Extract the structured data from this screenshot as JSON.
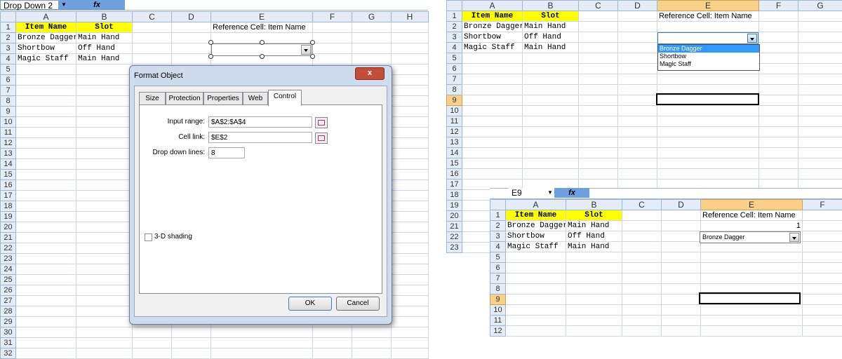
{
  "left": {
    "name_box": "Drop Down 2",
    "fx": "fx",
    "columns": [
      "A",
      "B",
      "C",
      "D",
      "E",
      "F",
      "G",
      "H"
    ],
    "rows": [
      "1",
      "2",
      "3",
      "4",
      "5",
      "6",
      "7",
      "8",
      "9",
      "10",
      "11",
      "12",
      "13",
      "14",
      "15",
      "16",
      "17",
      "18",
      "19",
      "20",
      "21",
      "22",
      "23",
      "24",
      "25",
      "26",
      "27",
      "28",
      "29",
      "30",
      "31",
      "32"
    ],
    "cells": [
      [
        "Item Name",
        "Slot",
        "",
        "",
        "Reference Cell: Item Name",
        "",
        "",
        ""
      ],
      [
        "Bronze Dagger",
        "Main Hand",
        "",
        "",
        "",
        "",
        "",
        ""
      ],
      [
        "Shortbow",
        "Off Hand",
        "",
        "",
        "",
        "",
        "",
        ""
      ],
      [
        "Magic Staff",
        "Main Hand",
        "",
        "",
        "",
        "",
        "",
        ""
      ]
    ]
  },
  "dialog": {
    "title": "Format Object",
    "close": "x",
    "tabs": [
      "Size",
      "Protection",
      "Properties",
      "Web",
      "Control"
    ],
    "active_tab": "Control",
    "input_range_label": "Input range:",
    "input_range_value": "$A$2:$A$4",
    "cell_link_label": "Cell link:",
    "cell_link_value": "$E$2",
    "drop_down_lines_label": "Drop down lines:",
    "drop_down_lines_value": "8",
    "shading_label": "3-D shading",
    "ok": "OK",
    "cancel": "Cancel"
  },
  "right_top": {
    "columns": [
      "A",
      "B",
      "C",
      "D",
      "E",
      "F",
      "G"
    ],
    "rows": [
      "1",
      "2",
      "3",
      "4",
      "5",
      "6",
      "7",
      "8",
      "9",
      "10",
      "11",
      "12",
      "13",
      "14",
      "15",
      "16",
      "17",
      "18",
      "19",
      "20",
      "21",
      "22",
      "23"
    ],
    "cells": [
      [
        "Item Name",
        "Slot",
        "",
        "",
        "Reference Cell: Item Name",
        "",
        ""
      ],
      [
        "Bronze Dagger",
        "Main Hand",
        "",
        "",
        "",
        "",
        ""
      ],
      [
        "Shortbow",
        "Off Hand",
        "",
        "",
        "",
        "",
        ""
      ],
      [
        "Magic Staff",
        "Main Hand",
        "",
        "",
        "",
        "",
        ""
      ]
    ],
    "dropdown_options": [
      "Bronze Dagger",
      "Shortbow",
      "Magic Staff"
    ],
    "dropdown_selected": "Bronze Dagger"
  },
  "right_bottom": {
    "name_box": "E9",
    "fx": "fx",
    "columns": [
      "A",
      "B",
      "C",
      "D",
      "E",
      "F"
    ],
    "rows": [
      "1",
      "2",
      "3",
      "4",
      "5",
      "6",
      "7",
      "8",
      "9",
      "10",
      "11",
      "12"
    ],
    "cells": [
      [
        "Item Name",
        "Slot",
        "",
        "",
        "Reference Cell: Item Name",
        ""
      ],
      [
        "Bronze Dagger",
        "Main Hand",
        "",
        "",
        "1",
        ""
      ],
      [
        "Shortbow",
        "Off Hand",
        "",
        "",
        "",
        ""
      ],
      [
        "Magic Staff",
        "Main Hand",
        "",
        "",
        "",
        ""
      ]
    ],
    "combo_value": "Bronze Dagger"
  },
  "colors": {
    "header_fill": "#ffff00",
    "col_header": "#e4ecf7",
    "selected_header": "#f8d08a",
    "dialog": "#cfdcee",
    "close_button": "#c44d3a"
  }
}
